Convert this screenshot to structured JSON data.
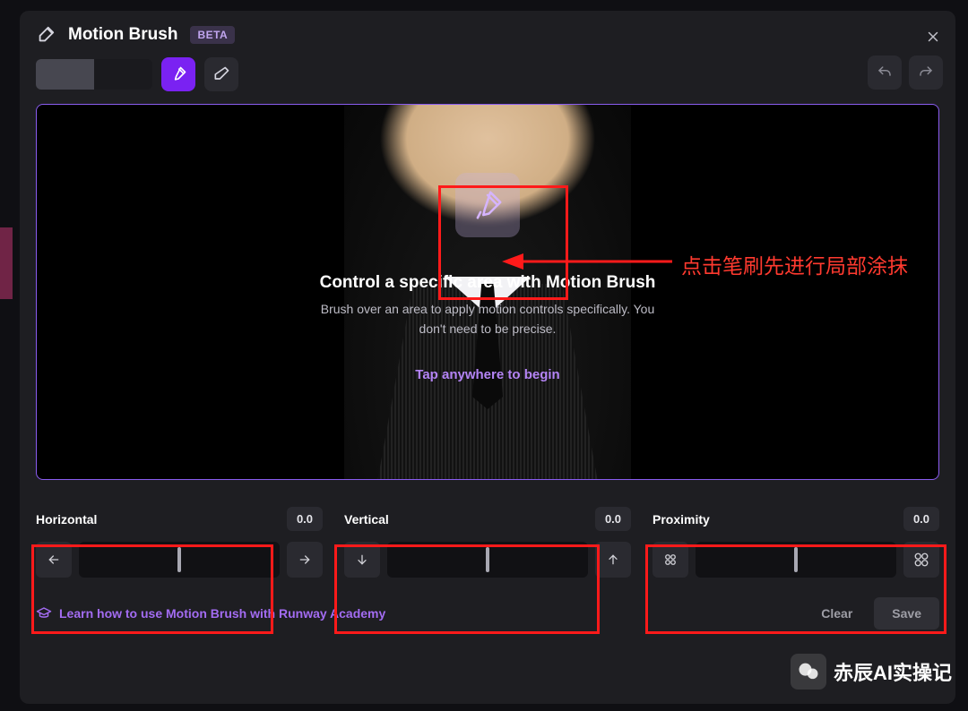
{
  "header": {
    "title": "Motion Brush",
    "badge": "BETA"
  },
  "toolbar": {
    "brush_tool": "brush",
    "eraser_tool": "eraser",
    "undo": "undo",
    "redo": "redo"
  },
  "overlay": {
    "heading": "Control a specific area with Motion Brush",
    "description_line1": "Brush over an area to apply motion controls specifically. You",
    "description_line2": "don't need to be precise.",
    "cta": "Tap anywhere to begin"
  },
  "sliders": {
    "horizontal": {
      "label": "Horizontal",
      "value": "0.0",
      "icon_left": "arrow-left",
      "icon_right": "arrow-right"
    },
    "vertical": {
      "label": "Vertical",
      "value": "0.0",
      "icon_left": "arrow-down",
      "icon_right": "arrow-up"
    },
    "proximity": {
      "label": "Proximity",
      "value": "0.0",
      "icon_left": "zoom-out-icon",
      "icon_right": "zoom-in-icon"
    }
  },
  "footer": {
    "learn": "Learn how to use Motion Brush with Runway Academy",
    "clear": "Clear",
    "save": "Save"
  },
  "annotations": {
    "brush_hint": "点击笔刷先进行局部涂抹",
    "watermark": "赤辰AI实操记"
  }
}
